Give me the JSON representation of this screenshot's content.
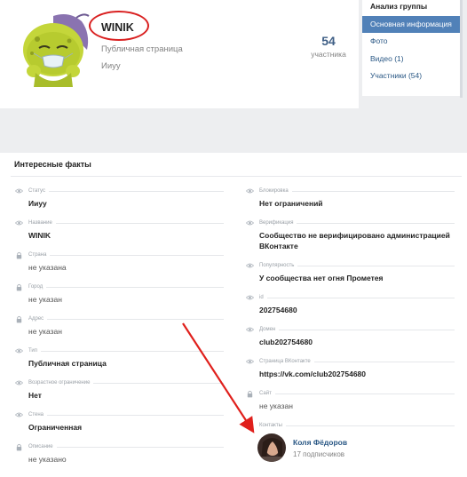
{
  "profile": {
    "name": "WINIK",
    "type": "Публичная страница",
    "status": "Ииуу",
    "followers_count": "54",
    "followers_label": "участника"
  },
  "menu": {
    "items": [
      {
        "label": "Анализ группы"
      },
      {
        "label": "Основная информация"
      },
      {
        "label": "Фото"
      },
      {
        "label": "Видео (1)"
      },
      {
        "label": "Участники (54)"
      }
    ]
  },
  "facts": {
    "title": "Интересные факты",
    "left": [
      {
        "label": "Статус",
        "value": "Ииуу",
        "icon": "eye-icon"
      },
      {
        "label": "Название",
        "value": "WINIK",
        "icon": "eye-icon"
      },
      {
        "label": "Страна",
        "value": "не указана",
        "icon": "lock-icon"
      },
      {
        "label": "Город",
        "value": "не указан",
        "icon": "lock-icon"
      },
      {
        "label": "Адрес",
        "value": "не указан",
        "icon": "lock-icon"
      },
      {
        "label": "Тип",
        "value": "Публичная страница",
        "icon": "eye-icon"
      },
      {
        "label": "Возрастное ограничение",
        "value": "Нет",
        "icon": "eye-icon"
      },
      {
        "label": "Стена",
        "value": "Ограниченная",
        "icon": "eye-icon"
      },
      {
        "label": "Описание",
        "value": "не указано",
        "icon": "lock-icon"
      }
    ],
    "right": [
      {
        "label": "Блокировка",
        "value": "Нет ограничений",
        "icon": "eye-icon"
      },
      {
        "label": "Верификация",
        "value": "Сообщество не верифицировано администрацией ВКонтакте",
        "icon": "eye-icon"
      },
      {
        "label": "Популярность",
        "value": "У сообщества нет огня Прометея",
        "icon": "eye-icon"
      },
      {
        "label": "id",
        "value": "202754680",
        "icon": "eye-icon"
      },
      {
        "label": "Домен",
        "value": "club202754680",
        "icon": "eye-icon"
      },
      {
        "label": "Страница ВКонтакте",
        "value": "https://vk.com/club202754680",
        "icon": "eye-icon"
      },
      {
        "label": "Сайт",
        "value": "не указан",
        "icon": "lock-icon"
      }
    ],
    "contacts": {
      "label": "Контакты",
      "name": "Коля Фёдоров",
      "subscribers": "17 подписчиков"
    }
  },
  "colors": {
    "accent": "#5181b8",
    "link": "#2a5885",
    "annotation_red": "#d92020"
  }
}
